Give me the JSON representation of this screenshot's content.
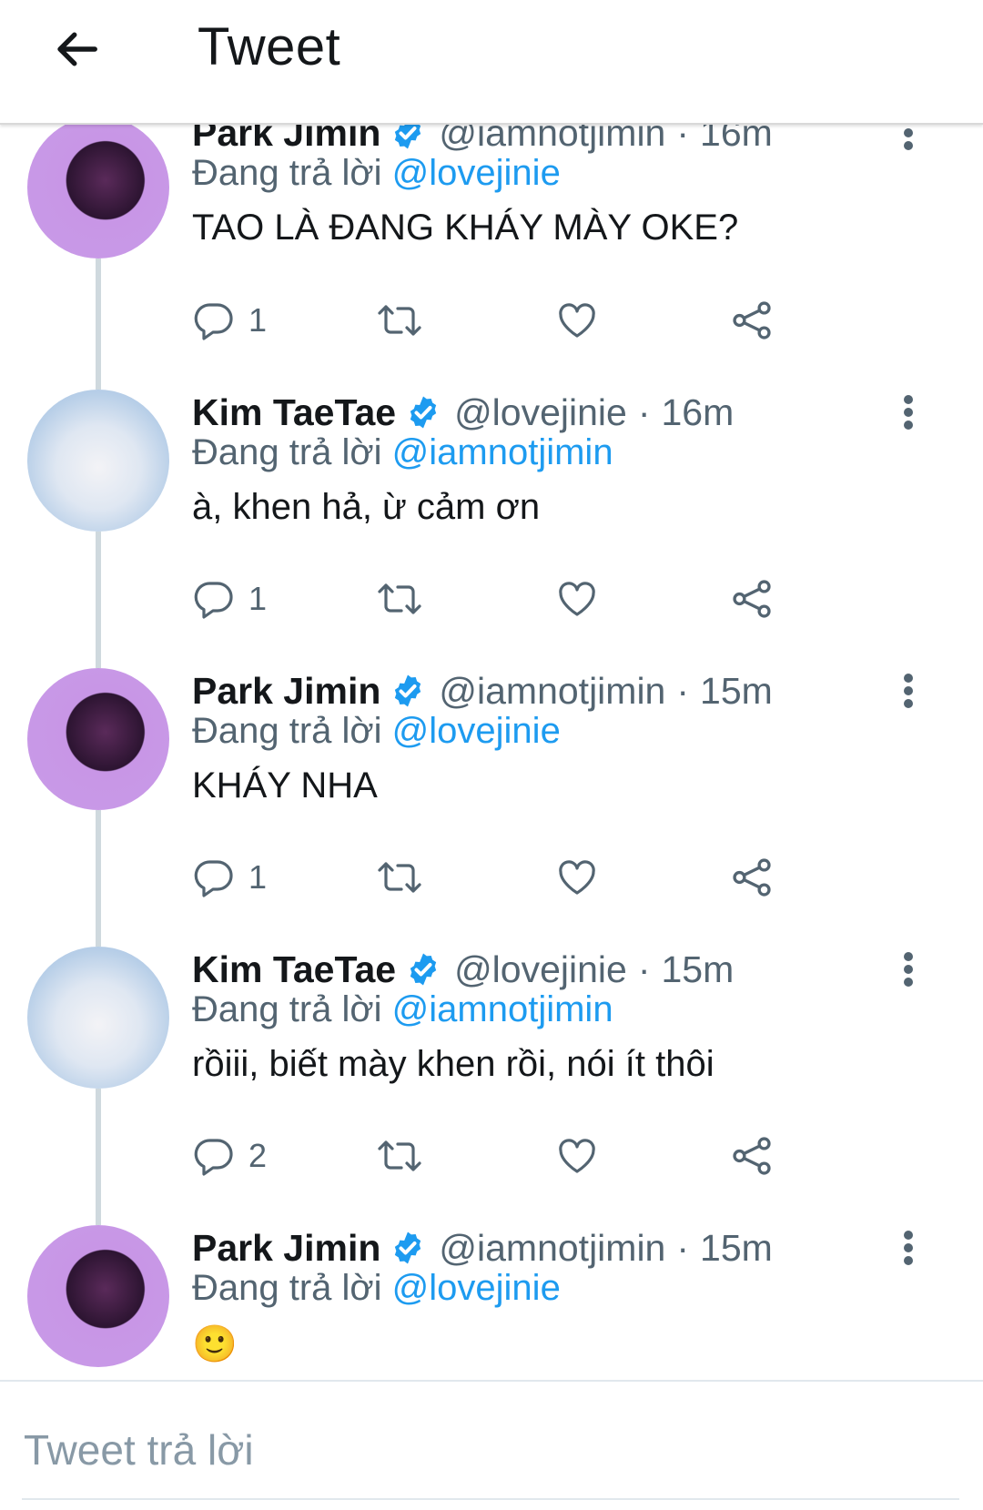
{
  "header": {
    "title": "Tweet"
  },
  "tweets": [
    {
      "name": "Park Jimin",
      "handle": "@iamnotjimin",
      "time": "16m",
      "reply_label": "Đang trả lời",
      "reply_to": "@lovejinie",
      "text": "TAO LÀ ĐANG KHÁY MÀY OKE?",
      "reply_count": "1"
    },
    {
      "name": "Kim TaeTae",
      "handle": "@lovejinie",
      "time": "16m",
      "reply_label": "Đang trả lời",
      "reply_to": "@iamnotjimin",
      "text": "à, khen hả, ừ cảm ơn",
      "reply_count": "1"
    },
    {
      "name": "Park Jimin",
      "handle": "@iamnotjimin",
      "time": "15m",
      "reply_label": "Đang trả lời",
      "reply_to": "@lovejinie",
      "text": "KHÁY NHA",
      "reply_count": "1"
    },
    {
      "name": "Kim TaeTae",
      "handle": "@lovejinie",
      "time": "15m",
      "reply_label": "Đang trả lời",
      "reply_to": "@iamnotjimin",
      "text": "rồiii, biết mày khen rồi, nói ít thôi",
      "reply_count": "2"
    },
    {
      "name": "Park Jimin",
      "handle": "@iamnotjimin",
      "time": "15m",
      "reply_label": "Đang trả lời",
      "reply_to": "@lovejinie",
      "text": "🙂",
      "reply_count": ""
    }
  ],
  "separator": "·",
  "reply_bar": {
    "placeholder": "Tweet trả lời"
  },
  "icons": {
    "back": "arrow-left-icon",
    "verified": "verified-badge-icon",
    "more": "more-vertical-icon",
    "reply": "reply-icon",
    "retweet": "retweet-icon",
    "like": "heart-icon",
    "share": "share-icon"
  },
  "colors": {
    "link": "#1d9bf0",
    "verified": "#1d9bf0",
    "muted": "#536471",
    "text": "#14171a"
  }
}
